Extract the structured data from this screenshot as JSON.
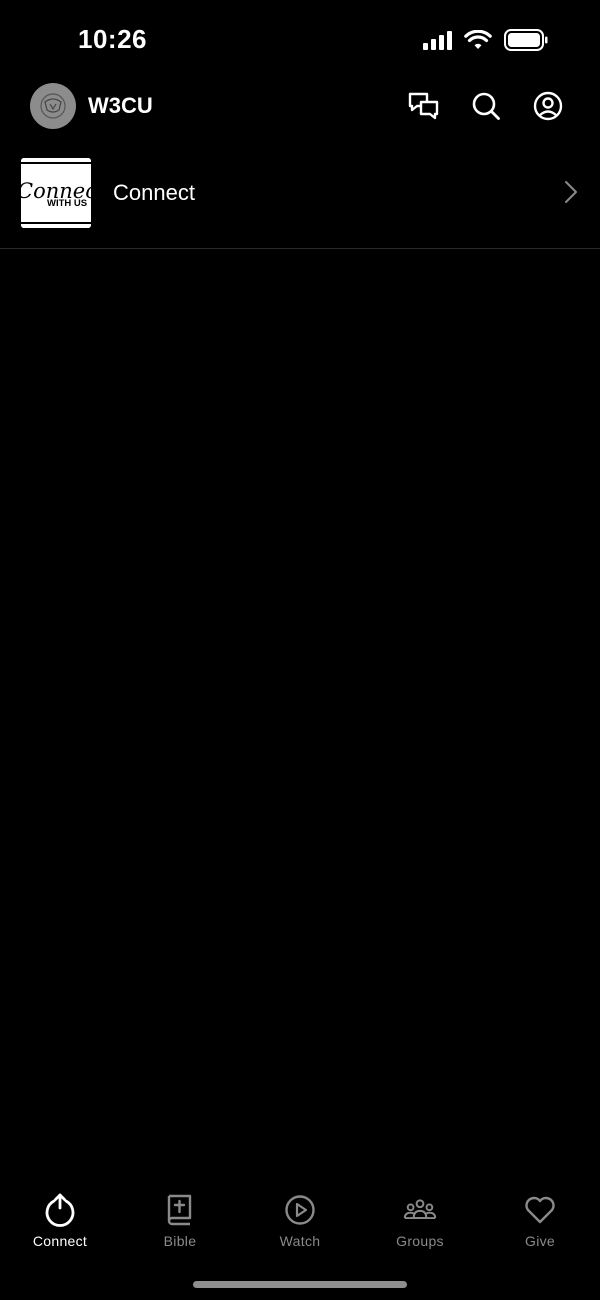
{
  "status_bar": {
    "time": "10:26"
  },
  "header": {
    "title": "W3CU",
    "actions": [
      {
        "name": "messages-icon"
      },
      {
        "name": "search-icon"
      },
      {
        "name": "profile-icon"
      }
    ]
  },
  "list": {
    "items": [
      {
        "label": "Connect",
        "thumbnail": {
          "script_text": "Connect",
          "caption": "WITH US"
        }
      }
    ]
  },
  "tab_bar": {
    "tabs": [
      {
        "label": "Connect",
        "icon": "power-icon",
        "active": true
      },
      {
        "label": "Bible",
        "icon": "bible-icon",
        "active": false
      },
      {
        "label": "Watch",
        "icon": "play-icon",
        "active": false
      },
      {
        "label": "Groups",
        "icon": "groups-icon",
        "active": false
      },
      {
        "label": "Give",
        "icon": "heart-icon",
        "active": false
      }
    ]
  },
  "colors": {
    "background": "#000000",
    "active_tab": "#ffffff",
    "inactive_tab": "#8a8a8a",
    "divider": "#2a2a2a"
  }
}
